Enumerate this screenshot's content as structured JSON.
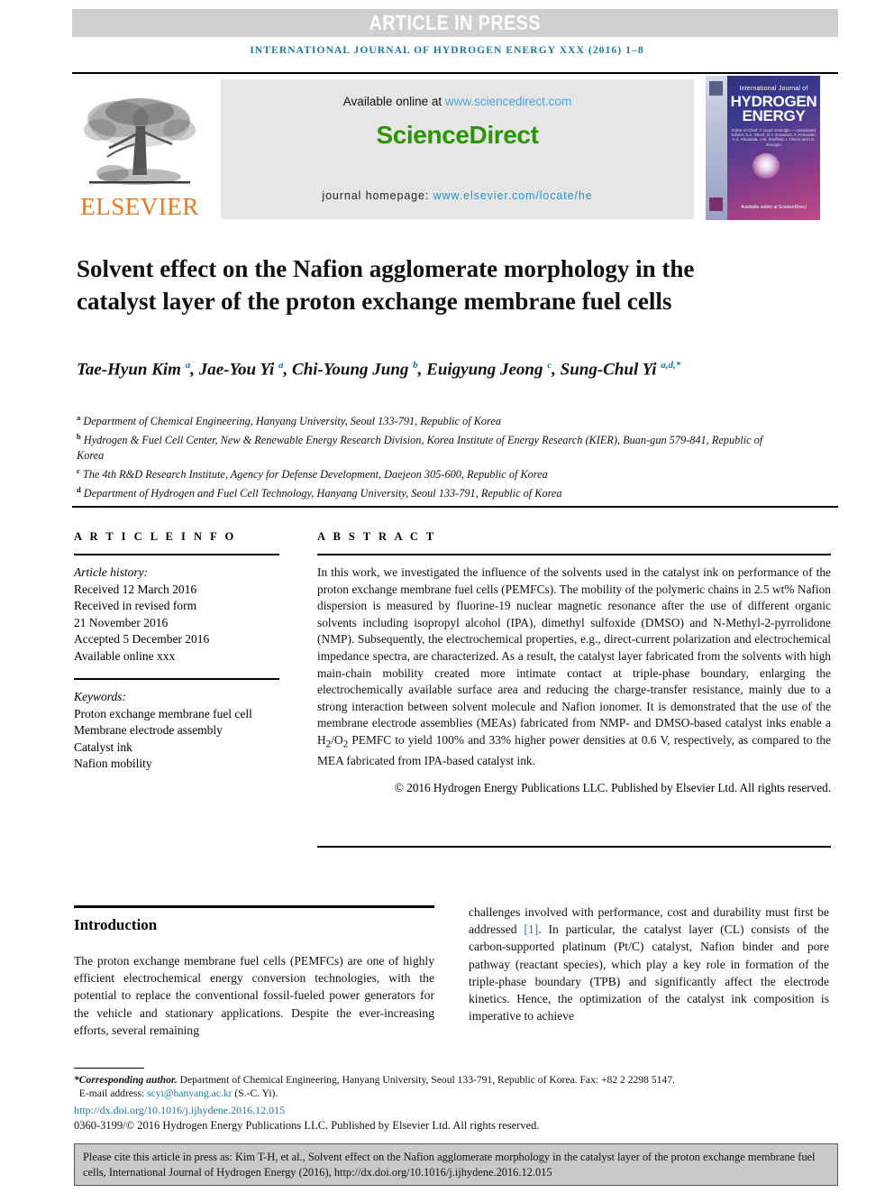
{
  "banner": {
    "press_label": "ARTICLE IN PRESS",
    "journal_running_head": "INTERNATIONAL JOURNAL OF HYDROGEN ENERGY XXX (2016) 1–8",
    "colors": {
      "banner_bg": "#cfcfcf",
      "journal_blue": "#1879a8"
    }
  },
  "masthead": {
    "publisher_wordmark": "ELSEVIER",
    "available_prefix": "Available online at ",
    "available_url": "www.sciencedirect.com",
    "sciencedirect_logo": "ScienceDirect",
    "homepage_prefix": "journal homepage: ",
    "homepage_url": "www.elsevier.com/locate/he",
    "colors": {
      "elsevier_orange": "#e87722",
      "sd_green": "#2a9406",
      "link_blue": "#4da3d4",
      "banner_bg": "#e6e6e6"
    },
    "cover": {
      "line_small": "International Journal of",
      "line_big_1": "HYDROGEN",
      "line_big_2": "ENERGY",
      "editors": "Editor-in-Chief: T. Nejat Veziroğlu — Associated Editors: S.A. Sherif, D.Y. Goswami, A. Al-Kuwari, A.S. Abuadala, J.W. Sheffield, I. Dincer and I.E. Ikonoglu",
      "footer_mark": "Available online at ScienceDirect"
    }
  },
  "article": {
    "title": "Solvent effect on the Nafion agglomerate morphology in the catalyst layer of the proton exchange membrane fuel cells",
    "authors_html": "Tae-Hyun Kim <sup>a</sup>, Jae-You Yi <sup>a</sup>, Chi-Young Jung <sup>b</sup>, Euigyung Jeong <sup>c</sup>, Sung-Chul Yi <sup>a,d,*</sup>",
    "affiliations": [
      {
        "marker": "a",
        "text": "Department of Chemical Engineering, Hanyang University, Seoul 133-791, Republic of Korea"
      },
      {
        "marker": "b",
        "text": "Hydrogen & Fuel Cell Center, New & Renewable Energy Research Division, Korea Institute of Energy Research (KIER), Buan-gun 579-841, Republic of Korea"
      },
      {
        "marker": "c",
        "text": "The 4th R&D Research Institute, Agency for Defense Development, Daejeon 305-600, Republic of Korea"
      },
      {
        "marker": "d",
        "text": "Department of Hydrogen and Fuel Cell Technology, Hanyang University, Seoul 133-791, Republic of Korea"
      }
    ]
  },
  "article_info": {
    "section_label": "A R T I C L E   I N F O",
    "history_label": "Article history:",
    "history": [
      "Received 12 March 2016",
      "Received in revised form",
      "21 November 2016",
      "Accepted 5 December 2016",
      "Available online xxx"
    ],
    "keywords_label": "Keywords:",
    "keywords": [
      "Proton exchange membrane fuel cell",
      "Membrane electrode assembly",
      "Catalyst ink",
      "Nafion mobility"
    ]
  },
  "abstract": {
    "section_label": "A B S T R A C T",
    "body": "In this work, we investigated the influence of the solvents used in the catalyst ink on performance of the proton exchange membrane fuel cells (PEMFCs). The mobility of the polymeric chains in 2.5 wt% Nafion dispersion is measured by fluorine-19 nuclear magnetic resonance after the use of different organic solvents including isopropyl alcohol (IPA), dimethyl sulfoxide (DMSO) and N-Methyl-2-pyrrolidone (NMP). Subsequently, the electrochemical properties, e.g., direct-current polarization and electrochemical impedance spectra, are characterized. As a result, the catalyst layer fabricated from the solvents with high main-chain mobility created more intimate contact at triple-phase boundary, enlarging the electrochemically available surface area and reducing the charge-transfer resistance, mainly due to a strong interaction between solvent molecule and Nafion ionomer. It is demonstrated that the use of the membrane electrode assemblies (MEAs) fabricated from NMP- and DMSO-based catalyst inks enable a H2/O2 PEMFC to yield 100% and 33% higher power densities at 0.6 V, respectively, as compared to the MEA fabricated from IPA-based catalyst ink.",
    "copyright": "© 2016 Hydrogen Energy Publications LLC. Published by Elsevier Ltd. All rights reserved."
  },
  "introduction": {
    "heading": "Introduction",
    "left_column": "The proton exchange membrane fuel cells (PEMFCs) are one of highly efficient electrochemical energy conversion technologies, with the potential to replace the conventional fossil-fueled power generators for the vehicle and stationary applications. Despite the ever-increasing efforts, several remaining",
    "right_column_pre": "challenges involved with performance, cost and durability must first be addressed ",
    "right_column_ref": "[1]",
    "right_column_post": ". In particular, the catalyst layer (CL) consists of the carbon-supported platinum (Pt/C) catalyst, Nafion binder and pore pathway (reactant species), which play a key role in formation of the triple-phase boundary (TPB) and significantly affect the electrode kinetics. Hence, the optimization of the catalyst ink composition is imperative to achieve"
  },
  "footnotes": {
    "corresponding_label": "*Corresponding author.",
    "corresponding_text": " Department of Chemical Engineering, Hanyang University, Seoul 133-791, Republic of Korea. Fax: +82 2 2298 5147.",
    "email_label": "E-mail address: ",
    "email": "scyi@hanyang.ac.kr",
    "email_suffix": " (S.-C. Yi).",
    "doi": "http://dx.doi.org/10.1016/j.ijhydene.2016.12.015",
    "issn": "0360-3199/© 2016 Hydrogen Energy Publications LLC. Published by Elsevier Ltd. All rights reserved."
  },
  "cite_box": {
    "text": "Please cite this article in press as: Kim T-H, et al., Solvent effect on the Nafion agglomerate morphology in the catalyst layer of the proton exchange membrane fuel cells, International Journal of Hydrogen Energy (2016), http://dx.doi.org/10.1016/j.ijhydene.2016.12.015"
  }
}
